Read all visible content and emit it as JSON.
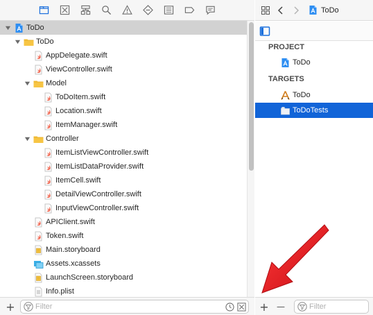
{
  "navigator": {
    "toolbar_icons": [
      "folder-icon",
      "source-control-icon",
      "hierarchy-icon",
      "search-icon",
      "warning-icon",
      "diamond-icon",
      "list-icon",
      "tag-icon",
      "chat-icon"
    ],
    "tree": [
      {
        "label": "ToDo",
        "level": 0,
        "kind": "project",
        "disclosure": "open",
        "selected": true
      },
      {
        "label": "ToDo",
        "level": 1,
        "kind": "folder",
        "disclosure": "open"
      },
      {
        "label": "AppDelegate.swift",
        "level": 2,
        "kind": "swift"
      },
      {
        "label": "ViewController.swift",
        "level": 2,
        "kind": "swift"
      },
      {
        "label": "Model",
        "level": 2,
        "kind": "folder",
        "disclosure": "open"
      },
      {
        "label": "ToDoItem.swift",
        "level": 3,
        "kind": "swift"
      },
      {
        "label": "Location.swift",
        "level": 3,
        "kind": "swift"
      },
      {
        "label": "ItemManager.swift",
        "level": 3,
        "kind": "swift"
      },
      {
        "label": "Controller",
        "level": 2,
        "kind": "folder",
        "disclosure": "open"
      },
      {
        "label": "ItemListViewController.swift",
        "level": 3,
        "kind": "swift"
      },
      {
        "label": "ItemListDataProvider.swift",
        "level": 3,
        "kind": "swift"
      },
      {
        "label": "ItemCell.swift",
        "level": 3,
        "kind": "swift"
      },
      {
        "label": "DetailViewController.swift",
        "level": 3,
        "kind": "swift"
      },
      {
        "label": "InputViewController.swift",
        "level": 3,
        "kind": "swift"
      },
      {
        "label": "APIClient.swift",
        "level": 2,
        "kind": "swift"
      },
      {
        "label": "Token.swift",
        "level": 2,
        "kind": "swift"
      },
      {
        "label": "Main.storyboard",
        "level": 2,
        "kind": "storyboard"
      },
      {
        "label": "Assets.xcassets",
        "level": 2,
        "kind": "assets"
      },
      {
        "label": "LaunchScreen.storyboard",
        "level": 2,
        "kind": "storyboard"
      },
      {
        "label": "Info.plist",
        "level": 2,
        "kind": "plist"
      }
    ],
    "filter_placeholder": "Filter"
  },
  "jump_bar": {
    "crumb": "ToDo"
  },
  "project_panel": {
    "project_header": "PROJECT",
    "project_item": "ToDo",
    "targets_header": "TARGETS",
    "targets": [
      {
        "label": "ToDo",
        "icon": "app-target-icon",
        "selected": false
      },
      {
        "label": "ToDoTests",
        "icon": "test-bundle-icon",
        "selected": true
      }
    ],
    "filter_placeholder": "Filter",
    "add_symbol": "+",
    "remove_symbol": "—"
  },
  "colors": {
    "selection_blue": "#1164d8",
    "selection_gray": "#d2d2d2",
    "folder_yellow": "#f7c544",
    "arrow_red": "#e8141c"
  }
}
